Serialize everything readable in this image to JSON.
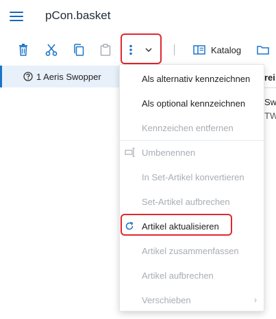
{
  "app": {
    "title": "pCon.basket"
  },
  "toolbar": {
    "katalog_label": "Katalog"
  },
  "tree": {
    "items": [
      {
        "label": "1 Aeris Swopper"
      }
    ]
  },
  "detail": {
    "header": "rei",
    "value1": "Sw",
    "value2": "TW"
  },
  "menu": {
    "items": [
      {
        "label": "Als alternativ kennzeichnen"
      },
      {
        "label": "Als optional kennzeichnen"
      },
      {
        "label": "Kennzeichen entfernen"
      },
      {
        "label": "Umbenennen"
      },
      {
        "label": "In Set-Artikel konvertieren"
      },
      {
        "label": "Set-Artikel aufbrechen"
      },
      {
        "label": "Artikel aktualisieren"
      },
      {
        "label": "Artikel zusammenfassen"
      },
      {
        "label": "Artikel aufbrechen"
      },
      {
        "label": "Verschieben"
      }
    ],
    "submenu_chevron": "›"
  },
  "colors": {
    "accent": "#1a73c8",
    "highlight_border": "#e0262e",
    "disabled_text": "#a8adb3",
    "selected_row": "#e8f0fa"
  }
}
